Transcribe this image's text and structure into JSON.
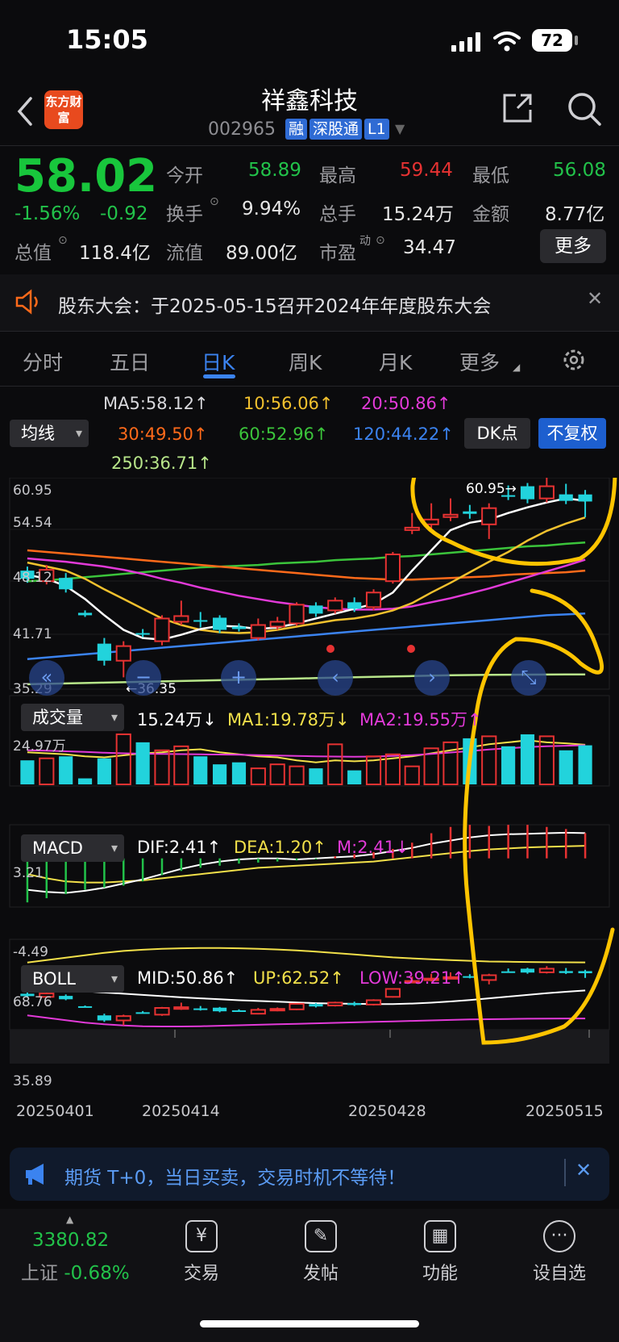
{
  "status_bar": {
    "time": "15:05",
    "battery": "72"
  },
  "header": {
    "logo_text": "东方财富",
    "stock_name": "祥鑫科技",
    "stock_code": "002965",
    "tags": [
      "融",
      "深股通",
      "L1"
    ]
  },
  "quote": {
    "price": "58.02",
    "change_pct": "-1.56%",
    "change": "-0.92",
    "market_cap_label": "总值",
    "market_cap": "118.4亿",
    "rows": [
      [
        {
          "label": "今开",
          "value": "58.89",
          "color": "#22c24a"
        },
        {
          "label": "最高",
          "value": "59.44",
          "color": "#e63232"
        },
        {
          "label": "最低",
          "value": "56.08",
          "color": "#22c24a"
        }
      ],
      [
        {
          "label": "换手",
          "value": "9.94%",
          "color": "#e6e6e6"
        },
        {
          "label": "总手",
          "value": "15.24万",
          "color": "#e6e6e6"
        },
        {
          "label": "金额",
          "value": "8.77亿",
          "color": "#e6e6e6"
        }
      ],
      [
        {
          "label": "流值",
          "value": "89.00亿",
          "color": "#e6e6e6"
        },
        {
          "label": "市盈",
          "value": "34.47",
          "color": "#e6e6e6"
        }
      ]
    ],
    "pe_superscript": "动",
    "more_label": "更多"
  },
  "notice": {
    "text": "股东大会：于2025-05-15召开2024年年度股东大会"
  },
  "tabs": [
    "分时",
    "五日",
    "日K",
    "周K",
    "月K",
    "更多"
  ],
  "active_tab": "日K",
  "ma_panel": {
    "selector": "均线",
    "items": [
      {
        "text": "MA5:58.12↑",
        "color": "#e8e8e8"
      },
      {
        "text": "10:56.06↑",
        "color": "#f2c12e"
      },
      {
        "text": "20:50.86↑",
        "color": "#e23ad8"
      },
      {
        "text": "30:49.50↑",
        "color": "#ff6a1a"
      },
      {
        "text": "60:52.96↑",
        "color": "#3bc43b"
      },
      {
        "text": "120:44.22↑",
        "color": "#3b83f0"
      },
      {
        "text": "250:36.71↑",
        "color": "#b8e68a"
      }
    ],
    "dk_label": "DK点",
    "fq_label": "不复权"
  },
  "kline": {
    "y_labels": [
      "60.95",
      "54.54",
      "48.12",
      "41.71",
      "35.29"
    ],
    "high_marker": "60.95→",
    "low_marker": "←36.35",
    "controls": [
      "«",
      "−",
      "+",
      "‹",
      "›",
      "⤡"
    ]
  },
  "volume": {
    "selector": "成交量",
    "value": "15.24万↓",
    "ma1": "MA1:19.78万↓",
    "ma2": "MA2:19.55万↑",
    "y_label": "24.97万"
  },
  "macd": {
    "selector": "MACD",
    "dif": "DIF:2.41↑",
    "dea": "DEA:1.20↑",
    "m": "M:2.41↓",
    "y_top": "3.21",
    "y_bottom": "-4.49"
  },
  "boll": {
    "selector": "BOLL",
    "mid": "MID:50.86↑",
    "up": "UP:62.52↑",
    "low": "LOW:39.21↑",
    "y_top": "68.76",
    "y_bottom": "35.89"
  },
  "x_dates": [
    "20250401",
    "20250414",
    "20250428",
    "20250515"
  ],
  "colors": {
    "up": "#e63232",
    "down": "#22d3dc",
    "accent": "#3b83f0",
    "annotation": "#ffc400"
  },
  "candles": [
    {
      "o": 49.5,
      "c": 48.5,
      "h": 50.0,
      "l": 48.0
    },
    {
      "o": 48.2,
      "c": 49.6,
      "h": 50.2,
      "l": 47.8
    },
    {
      "o": 48.6,
      "c": 47.2,
      "h": 49.2,
      "l": 46.8
    },
    {
      "o": 44.3,
      "c": 44.0,
      "h": 44.6,
      "l": 43.8
    },
    {
      "o": 40.5,
      "c": 38.4,
      "h": 41.2,
      "l": 37.8
    },
    {
      "o": 38.4,
      "c": 40.2,
      "h": 40.8,
      "l": 36.35
    },
    {
      "o": 41.8,
      "c": 41.6,
      "h": 42.3,
      "l": 41.3
    },
    {
      "o": 40.8,
      "c": 43.6,
      "h": 44.0,
      "l": 40.3
    },
    {
      "o": 43.2,
      "c": 43.9,
      "h": 45.8,
      "l": 42.8
    },
    {
      "o": 43.4,
      "c": 43.2,
      "h": 44.4,
      "l": 42.5
    },
    {
      "o": 43.7,
      "c": 42.2,
      "h": 44.0,
      "l": 41.8
    },
    {
      "o": 42.6,
      "c": 42.3,
      "h": 43.0,
      "l": 42.0
    },
    {
      "o": 41.2,
      "c": 42.8,
      "h": 43.6,
      "l": 40.9
    },
    {
      "o": 42.6,
      "c": 43.2,
      "h": 43.8,
      "l": 42.2
    },
    {
      "o": 43.0,
      "c": 45.3,
      "h": 45.6,
      "l": 42.7
    },
    {
      "o": 45.2,
      "c": 44.2,
      "h": 45.6,
      "l": 43.8
    },
    {
      "o": 44.6,
      "c": 45.8,
      "h": 46.2,
      "l": 44.2
    },
    {
      "o": 45.6,
      "c": 44.8,
      "h": 46.2,
      "l": 44.4
    },
    {
      "o": 45.0,
      "c": 46.8,
      "h": 47.2,
      "l": 44.6
    },
    {
      "o": 48.2,
      "c": 51.5,
      "h": 51.8,
      "l": 47.9
    },
    {
      "o": 54.5,
      "c": 54.8,
      "h": 56.6,
      "l": 54.0
    },
    {
      "o": 55.2,
      "c": 55.8,
      "h": 57.8,
      "l": 54.6
    },
    {
      "o": 56.1,
      "c": 56.4,
      "h": 58.4,
      "l": 55.6
    },
    {
      "o": 56.8,
      "c": 56.5,
      "h": 57.6,
      "l": 55.9
    },
    {
      "o": 55.2,
      "c": 57.2,
      "h": 57.8,
      "l": 53.4
    },
    {
      "o": 58.8,
      "c": 58.6,
      "h": 60.0,
      "l": 58.2
    },
    {
      "o": 59.9,
      "c": 58.3,
      "h": 60.3,
      "l": 57.8
    },
    {
      "o": 58.4,
      "c": 59.9,
      "h": 60.95,
      "l": 57.9
    },
    {
      "o": 58.9,
      "c": 58.1,
      "h": 60.2,
      "l": 57.7
    },
    {
      "o": 58.89,
      "c": 58.02,
      "h": 59.44,
      "l": 56.08
    }
  ],
  "volumes": [
    12,
    13,
    14,
    3,
    13,
    25,
    21,
    17,
    19,
    14,
    10,
    11,
    8,
    10,
    9,
    8,
    20,
    7,
    14,
    15,
    9,
    18,
    21,
    23,
    24,
    19,
    24.97,
    24,
    17,
    19.5
  ],
  "macd_hist": [
    -4.2,
    -3.8,
    -3.4,
    -3.0,
    -2.8,
    -2.6,
    -2.2,
    -1.6,
    -1.2,
    -0.9,
    -0.7,
    -0.5,
    -0.4,
    -0.3,
    -0.2,
    -0.1,
    0.2,
    0.4,
    0.6,
    0.9,
    1.5,
    2.4,
    3.0,
    3.2,
    3.1,
    3.2,
    3.2,
    3.0,
    2.8,
    2.41
  ],
  "series": {
    "ma5": [
      49,
      48.5,
      47.6,
      46,
      44,
      42.2,
      41.2,
      41.0,
      41.6,
      42.3,
      42.7,
      42.6,
      42.3,
      42.5,
      43,
      43.6,
      44.2,
      44.8,
      45.4,
      46.8,
      49.5,
      52,
      54.5,
      55.4,
      55.8,
      56.6,
      57.3,
      57.9,
      58.4,
      58.12
    ],
    "ma10": [
      50.5,
      50,
      49.5,
      48.5,
      47.2,
      46,
      44.8,
      43.6,
      42.8,
      42.2,
      41.9,
      41.8,
      41.9,
      42.2,
      42.6,
      43,
      43.4,
      43.6,
      44.0,
      44.6,
      45.5,
      46.8,
      48,
      49.3,
      50.6,
      51.8,
      53.2,
      54.4,
      55.3,
      56.06
    ],
    "ma20": [
      51,
      50.8,
      50.6,
      50.3,
      50,
      49.6,
      49.1,
      48.5,
      48,
      47.4,
      46.9,
      46.4,
      46,
      45.6,
      45.3,
      45,
      44.8,
      44.7,
      44.7,
      44.8,
      45.1,
      45.6,
      46.1,
      46.7,
      47.3,
      48,
      48.7,
      49.4,
      50.1,
      50.86
    ],
    "ma30": [
      52,
      51.8,
      51.6,
      51.4,
      51.2,
      51,
      50.8,
      50.6,
      50.4,
      50.2,
      50,
      49.8,
      49.6,
      49.4,
      49.2,
      49,
      48.8,
      48.6,
      48.5,
      48.4,
      48.4,
      48.5,
      48.6,
      48.7,
      48.8,
      49,
      49.1,
      49.2,
      49.3,
      49.5
    ],
    "ma60": [
      48.2,
      48.3,
      48.5,
      48.7,
      48.9,
      49.1,
      49.3,
      49.5,
      49.7,
      49.9,
      50,
      50.1,
      50.2,
      50.4,
      50.5,
      50.6,
      50.8,
      50.9,
      51.0,
      51.2,
      51.3,
      51.5,
      51.7,
      51.9,
      52.1,
      52.3,
      52.5,
      52.6,
      52.8,
      52.96
    ],
    "ma120": [
      38.6,
      38.8,
      39,
      39.2,
      39.4,
      39.6,
      39.8,
      40,
      40.2,
      40.4,
      40.6,
      40.8,
      41,
      41.2,
      41.4,
      41.6,
      41.8,
      42,
      42.2,
      42.4,
      42.6,
      42.8,
      43,
      43.2,
      43.4,
      43.6,
      43.8,
      44,
      44.1,
      44.22
    ],
    "ma250": [
      35.5,
      35.55,
      35.6,
      35.65,
      35.7,
      35.75,
      35.8,
      35.85,
      35.9,
      35.95,
      36.0,
      36.05,
      36.1,
      36.15,
      36.2,
      36.25,
      36.3,
      36.35,
      36.4,
      36.45,
      36.5,
      36.55,
      36.6,
      36.63,
      36.65,
      36.67,
      36.68,
      36.69,
      36.7,
      36.71
    ],
    "vol_ma1": [
      16,
      15.5,
      15,
      14,
      13.5,
      14.5,
      15.5,
      16,
      17,
      17.5,
      16,
      15,
      14,
      13.5,
      12,
      11,
      12,
      11.5,
      12,
      13,
      14,
      15.5,
      17,
      18.5,
      20,
      21,
      22,
      21,
      20.5,
      19.78
    ],
    "vol_ma2": [
      17,
      16.8,
      16.5,
      16.2,
      15.8,
      15.5,
      15.3,
      15.2,
      15.1,
      15,
      14.9,
      14.8,
      14.6,
      14.4,
      14.2,
      14,
      13.9,
      13.8,
      13.9,
      14.2,
      14.6,
      15.2,
      15.9,
      16.6,
      17.4,
      18,
      18.6,
      19,
      19.3,
      19.55
    ],
    "dif": [
      -3.0,
      -3.2,
      -3.3,
      -3.1,
      -2.8,
      -2.4,
      -2.0,
      -1.5,
      -1.0,
      -0.6,
      -0.3,
      -0.1,
      0.0,
      0.0,
      -0.1,
      0.0,
      0.1,
      0.2,
      0.4,
      0.7,
      1.0,
      1.4,
      1.7,
      2.0,
      2.2,
      2.3,
      2.35,
      2.4,
      2.45,
      2.41
    ],
    "dea": [
      -1.5,
      -1.9,
      -2.2,
      -2.3,
      -2.3,
      -2.2,
      -2.1,
      -1.9,
      -1.7,
      -1.5,
      -1.3,
      -1.1,
      -0.9,
      -0.8,
      -0.7,
      -0.6,
      -0.5,
      -0.4,
      -0.3,
      -0.1,
      0.1,
      0.3,
      0.5,
      0.7,
      0.85,
      0.95,
      1.05,
      1.1,
      1.15,
      1.2
    ],
    "boll_up": [
      62.5,
      63.5,
      64.5,
      65.5,
      66.5,
      67.3,
      67.8,
      68.2,
      68.4,
      68.5,
      68.5,
      68.4,
      68.2,
      67.9,
      67.5,
      67,
      66.4,
      65.8,
      65.2,
      64.6,
      64.2,
      63.8,
      63.5,
      63.2,
      62.9,
      62.8,
      62.7,
      62.6,
      62.55,
      62.52
    ],
    "boll_mid": [
      51.5,
      51.2,
      50.9,
      50.5,
      50.0,
      49.5,
      49.0,
      48.5,
      48.0,
      47.6,
      47.2,
      46.8,
      46.5,
      46.2,
      45.9,
      45.6,
      45.4,
      45.3,
      45.2,
      45.2,
      45.4,
      45.8,
      46.3,
      46.9,
      47.6,
      48.3,
      49.0,
      49.7,
      50.3,
      50.86
    ],
    "boll_low": [
      40.5,
      39.5,
      38.5,
      37.5,
      36.8,
      36.3,
      36.0,
      35.9,
      35.9,
      36.0,
      36.2,
      36.4,
      36.6,
      36.8,
      37.0,
      37.2,
      37.4,
      37.6,
      37.8,
      38.0,
      38.2,
      38.4,
      38.6,
      38.8,
      38.9,
      39.0,
      39.1,
      39.15,
      39.2,
      39.21
    ]
  }
}
